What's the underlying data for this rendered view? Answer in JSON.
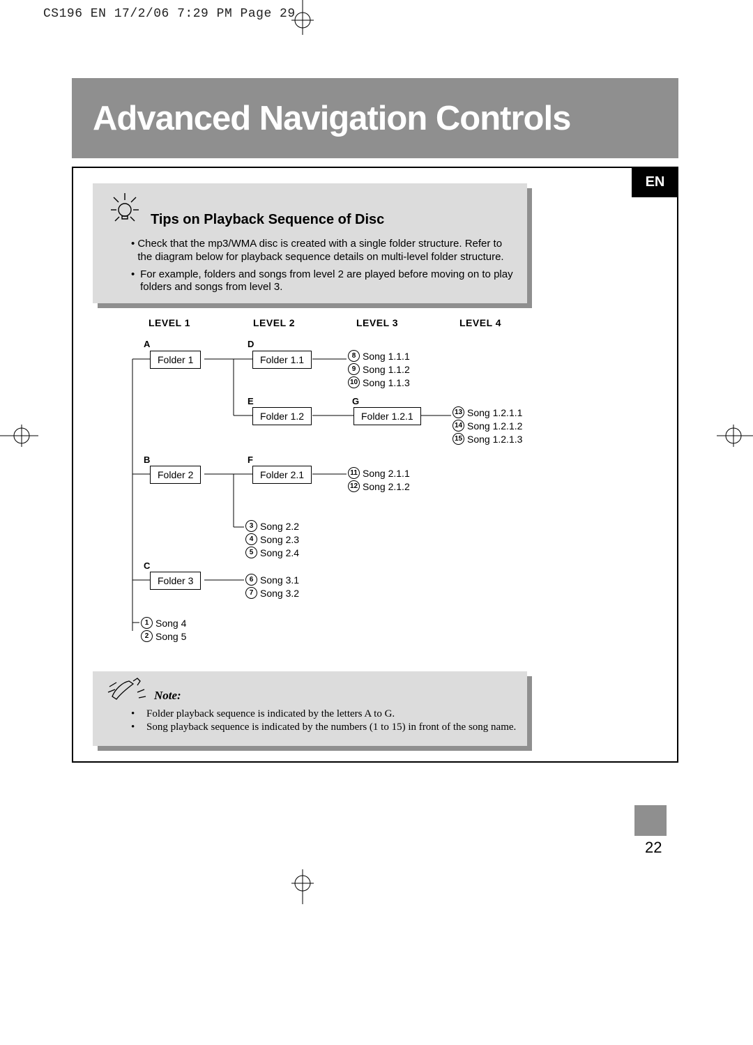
{
  "slug": "CS196 EN  17/2/06  7:29 PM  Page 29",
  "title": "Advanced Navigation Controls",
  "lang_tab": "EN",
  "tips": {
    "heading": "Tips on Playback Sequence of Disc",
    "items": [
      "Check that the mp3/WMA disc is created with a single folder structure. Refer to the diagram below for playback sequence details on multi-level folder structure.",
      "For example, folders and songs from level 2 are played before moving on to play folders and songs from level 3."
    ]
  },
  "levels": [
    "LEVEL 1",
    "LEVEL 2",
    "LEVEL 3",
    "LEVEL 4"
  ],
  "letters": {
    "A": "A",
    "B": "B",
    "C": "C",
    "D": "D",
    "E": "E",
    "F": "F",
    "G": "G"
  },
  "folders": {
    "f1": "Folder 1",
    "f2": "Folder 2",
    "f3": "Folder 3",
    "f11": "Folder 1.1",
    "f12": "Folder 1.2",
    "f21": "Folder 2.1",
    "f121": "Folder 1.2.1"
  },
  "songs": {
    "root": [
      {
        "n": "1",
        "t": "Song 4"
      },
      {
        "n": "2",
        "t": "Song 5"
      }
    ],
    "l2a": [
      {
        "n": "3",
        "t": "Song 2.2"
      },
      {
        "n": "4",
        "t": "Song 2.3"
      },
      {
        "n": "5",
        "t": "Song 2.4"
      }
    ],
    "l2b": [
      {
        "n": "6",
        "t": "Song 3.1"
      },
      {
        "n": "7",
        "t": "Song 3.2"
      }
    ],
    "l3a": [
      {
        "n": "8",
        "t": "Song 1.1.1"
      },
      {
        "n": "9",
        "t": "Song 1.1.2"
      },
      {
        "n": "10",
        "t": "Song 1.1.3"
      }
    ],
    "l3b": [
      {
        "n": "11",
        "t": "Song 2.1.1"
      },
      {
        "n": "12",
        "t": "Song 2.1.2"
      }
    ],
    "l4a": [
      {
        "n": "13",
        "t": "Song 1.2.1.1"
      },
      {
        "n": "14",
        "t": "Song 1.2.1.2"
      },
      {
        "n": "15",
        "t": "Song 1.2.1.3"
      }
    ]
  },
  "note": {
    "heading": "Note:",
    "items": [
      "Folder playback sequence is indicated by the letters A to G.",
      "Song playback sequence is indicated by the numbers (1 to 15) in front of the song name."
    ]
  },
  "page_number": "22"
}
